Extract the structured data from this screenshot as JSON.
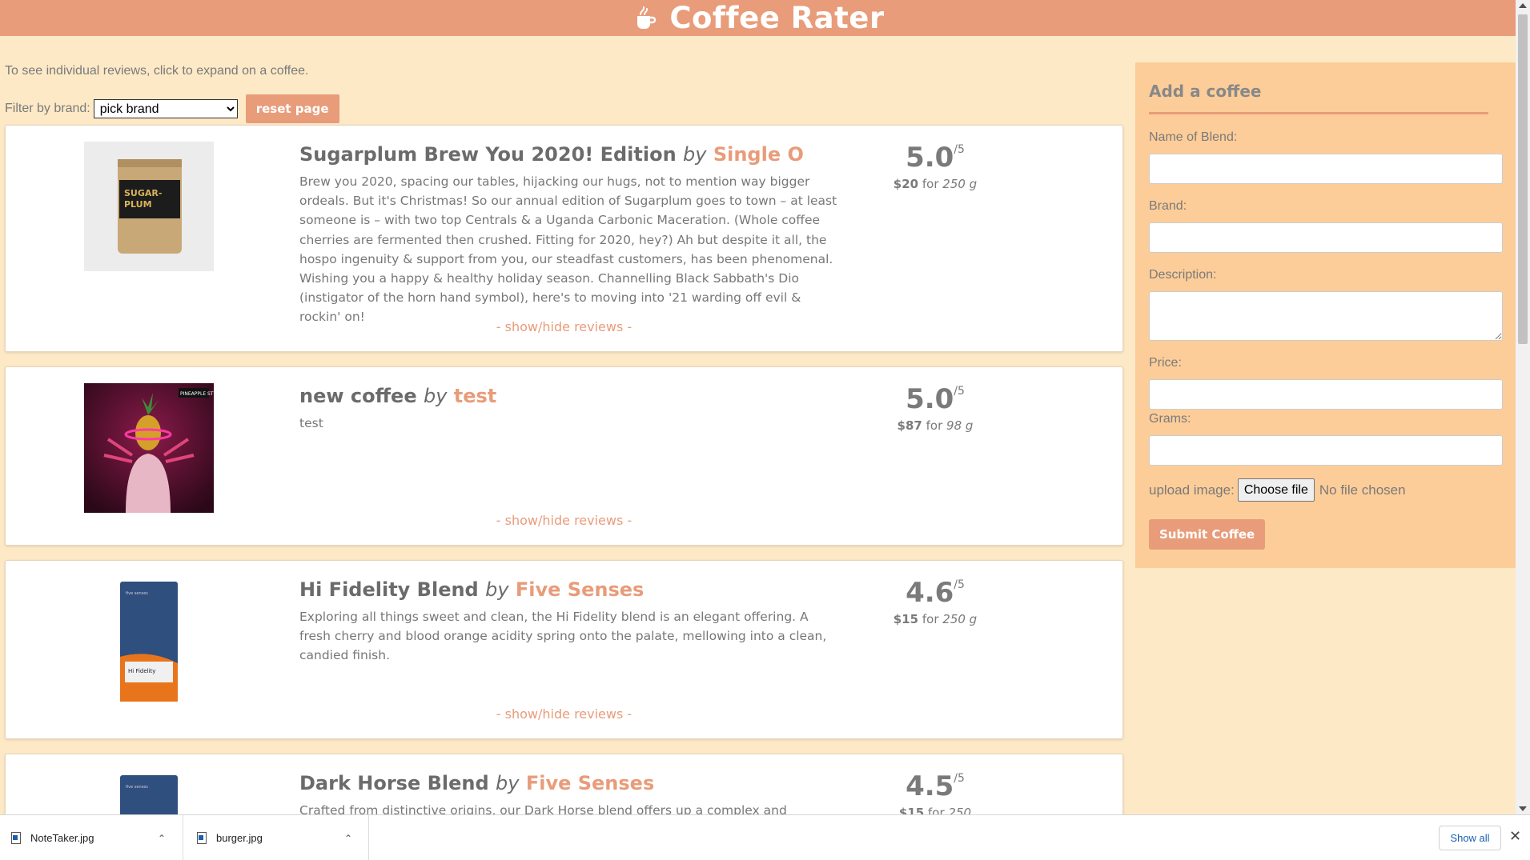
{
  "header": {
    "title": "Coffee Rater",
    "logo_icon": "coffee-cup-hand-icon"
  },
  "intro": "To see individual reviews, click to expand on a coffee.",
  "filter": {
    "label": "Filter by brand:",
    "selected": "pick brand",
    "reset_label": "reset page"
  },
  "coffees": [
    {
      "name": "Sugarplum Brew You 2020! Edition",
      "by": "by",
      "brand": "Single O",
      "description": "Brew you 2020, spacing our tables, hijacking our hugs, not to mention way bigger ordeals. But it's Christmas! So our annual edition of Sugarplum goes to town – at least someone is – with two top Centrals & a Uganda Carbonic Maceration. (Whole coffee cherries are fermented then crushed. Fitting for 2020, hey?) Ah but despite it all, the hospo ingenuity & support from you, our steadfast customers, has been phenomenal. Wishing you a happy & healthy holiday season. Channelling Black Sabbath's Dio (instigator of the horn hand symbol), here's to moving into '21 warding off evil & rockin' on!",
      "score": "5.0",
      "out_of": "/5",
      "price": "$20",
      "for": "for",
      "grams": "250 g",
      "toggle": "- show/hide reviews -",
      "image_icon": "sugarplum-coffee-bag-image",
      "image_text": "SUGAR-PLUM"
    },
    {
      "name": "new coffee",
      "by": "by",
      "brand": "test",
      "description": "test",
      "score": "5.0",
      "out_of": "/5",
      "price": "$87",
      "for": "for",
      "grams": "98 g",
      "toggle": "- show/hide reviews -",
      "image_icon": "pineapple-statue-image",
      "image_text": "PINEAPPLE ST"
    },
    {
      "name": "Hi Fidelity Blend",
      "by": "by",
      "brand": "Five Senses",
      "description": "Exploring all things sweet and clean, the Hi Fidelity blend is an elegant offering. A fresh cherry and blood orange acidity spring onto the palate, mellowing into a clean, candied finish.",
      "score": "4.6",
      "out_of": "/5",
      "price": "$15",
      "for": "for",
      "grams": "250 g",
      "toggle": "- show/hide reviews -",
      "image_icon": "hi-fidelity-coffee-bag-image",
      "image_text": "Hi Fidelity"
    },
    {
      "name": "Dark Horse Blend",
      "by": "by",
      "brand": "Five Senses",
      "description": "Crafted from distinctive origins, our Dark Horse blend offers up a complex and dynamic cup",
      "score": "4.5",
      "out_of": "/5",
      "price": "$15",
      "for": "for",
      "grams": "250",
      "image_icon": "dark-horse-coffee-bag-image"
    }
  ],
  "add_form": {
    "title": "Add a coffee",
    "name_label": "Name of Blend:",
    "brand_label": "Brand:",
    "description_label": "Description:",
    "price_label": "Price:",
    "grams_label": "Grams:",
    "upload_label": "upload image:",
    "choose_file": "Choose file",
    "no_file": "No file chosen",
    "submit": "Submit Coffee"
  },
  "downloads": {
    "items": [
      {
        "name": "NoteTaker.jpg",
        "icon": "image-file-icon"
      },
      {
        "name": "burger.jpg",
        "icon": "image-file-icon"
      }
    ],
    "show_all": "Show all",
    "close_icon": "close-icon"
  },
  "colors": {
    "accent": "#e89c7a",
    "background": "#fde9c6",
    "sidebar": "#fdcd99"
  }
}
